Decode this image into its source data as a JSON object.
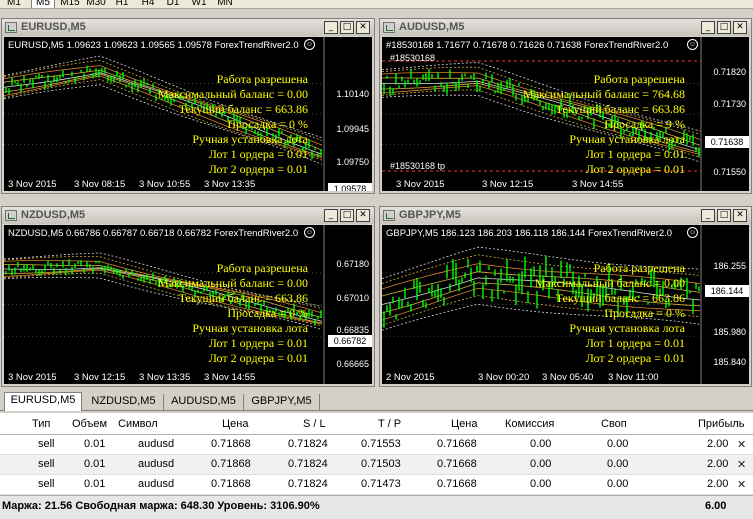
{
  "timeframes": {
    "items": [
      "M1",
      "M5",
      "M15",
      "M30",
      "H1",
      "H4",
      "D1",
      "W1",
      "MN"
    ],
    "active": "M5"
  },
  "charts": [
    {
      "window_title": "EURUSD,M5",
      "header_text": "EURUSD,M5  1.09623 1.09623 1.09565 1.09578 ForexTrendRiver2.0",
      "info_lines": [
        "Работа разрешена",
        "Максимальный баланс = 0.00",
        "Текущий баланс = 663.86",
        "Просадка = 0 %",
        "Ручная установка лота",
        "Лот 1 ордера = 0.01",
        "Лот 2 ордера = 0.01"
      ],
      "y_labels": [
        "1.10140",
        "1.09945",
        "1.09750"
      ],
      "price_tag": "1.09578",
      "x_labels": [
        "3 Nov 2015",
        "3 Nov 08:15",
        "3 Nov 10:55",
        "3 Nov 13:35"
      ],
      "ticket_labels": [],
      "bar_color": "#00ff00"
    },
    {
      "window_title": "AUDUSD,M5",
      "header_text": "#18530168 1.71677 0.71678 0.71626 0.71638 ForexTrendRiver2.0",
      "info_lines": [
        "Работа разрешена",
        "Максимальный баланс = 764.68",
        "Текущий баланс = 663.86",
        "Просадка = 9 %",
        "Ручная установка лота",
        "Лот 1 ордера = 0.01",
        "Лот 2 ордера = 0.01"
      ],
      "y_labels": [
        "0.71820",
        "0.71730",
        "0.71550"
      ],
      "price_tag": "0.71638",
      "x_labels": [
        "3 Nov 2015",
        "3 Nov 12:15",
        "3 Nov 14:55"
      ],
      "ticket_labels": [
        "#18530168",
        "#18530168 tp"
      ],
      "bar_color": "#00ff00"
    },
    {
      "window_title": "NZDUSD,M5",
      "header_text": "NZDUSD,M5  0.66786 0.66787 0.66718 0.66782 ForexTrendRiver2.0",
      "info_lines": [
        "Работа разрешена",
        "Максимальный баланс = 0.00",
        "Текущий баланс = 663.86",
        "Просадка = 0 %",
        "Ручная установка лота",
        "Лот 1 ордера = 0.01",
        "Лот 2 ордера = 0.01"
      ],
      "y_labels": [
        "0.67180",
        "0.67010",
        "0.66835",
        "0.66665"
      ],
      "price_tag": "0.66782",
      "x_labels": [
        "3 Nov 2015",
        "3 Nov 12:15",
        "3 Nov 13:35",
        "3 Nov 14:55"
      ],
      "ticket_labels": [],
      "bar_color": "#00ff00"
    },
    {
      "window_title": "GBPJPY,M5",
      "header_text": "GBPJPY,M5  186.123 186.203 186.118 186.144 ForexTrendRiver2.0",
      "info_lines": [
        "Работа разрешена",
        "Максимальный баланс = 0.00",
        "Текущий баланс = 663.86",
        "Просадка = 0 %",
        "Ручная установка лота",
        "Лот 1 ордера = 0.01",
        "Лот 2 ордера = 0.01"
      ],
      "y_labels": [
        "186.255",
        "185.980",
        "185.840"
      ],
      "price_tag": "186.144",
      "x_labels": [
        "2 Nov 2015",
        "3 Nov 00:20",
        "3 Nov 05:40",
        "3 Nov 11:00"
      ],
      "ticket_labels": [],
      "bar_color": "#00ff00"
    }
  ],
  "tabs": [
    "EURUSD,M5",
    "NZDUSD,M5",
    "AUDUSD,M5",
    "GBPJPY,M5"
  ],
  "active_tab": "EURUSD,M5",
  "table": {
    "headers": [
      "Тип",
      "Объем",
      "Символ",
      "Цена",
      "S / L",
      "T / P",
      "Цена",
      "Комиссия",
      "Своп",
      "Прибыль"
    ],
    "rows": [
      [
        "sell",
        "0.01",
        "audusd",
        "0.71868",
        "0.71824",
        "0.71553",
        "0.71668",
        "0.00",
        "0.00",
        "2.00"
      ],
      [
        "sell",
        "0.01",
        "audusd",
        "0.71868",
        "0.71824",
        "0.71503",
        "0.71668",
        "0.00",
        "0.00",
        "2.00"
      ],
      [
        "sell",
        "0.01",
        "audusd",
        "0.71868",
        "0.71824",
        "0.71473",
        "0.71668",
        "0.00",
        "0.00",
        "2.00"
      ]
    ],
    "close_symbol": "✕"
  },
  "summary": {
    "text": "Маржа: 21.56  Свободная маржа: 648.30  Уровень: 3106.90%",
    "total_profit": "6.00"
  },
  "window_buttons": {
    "minimize": "_",
    "maximize": "□",
    "close": "✕"
  },
  "smiley": "☺"
}
